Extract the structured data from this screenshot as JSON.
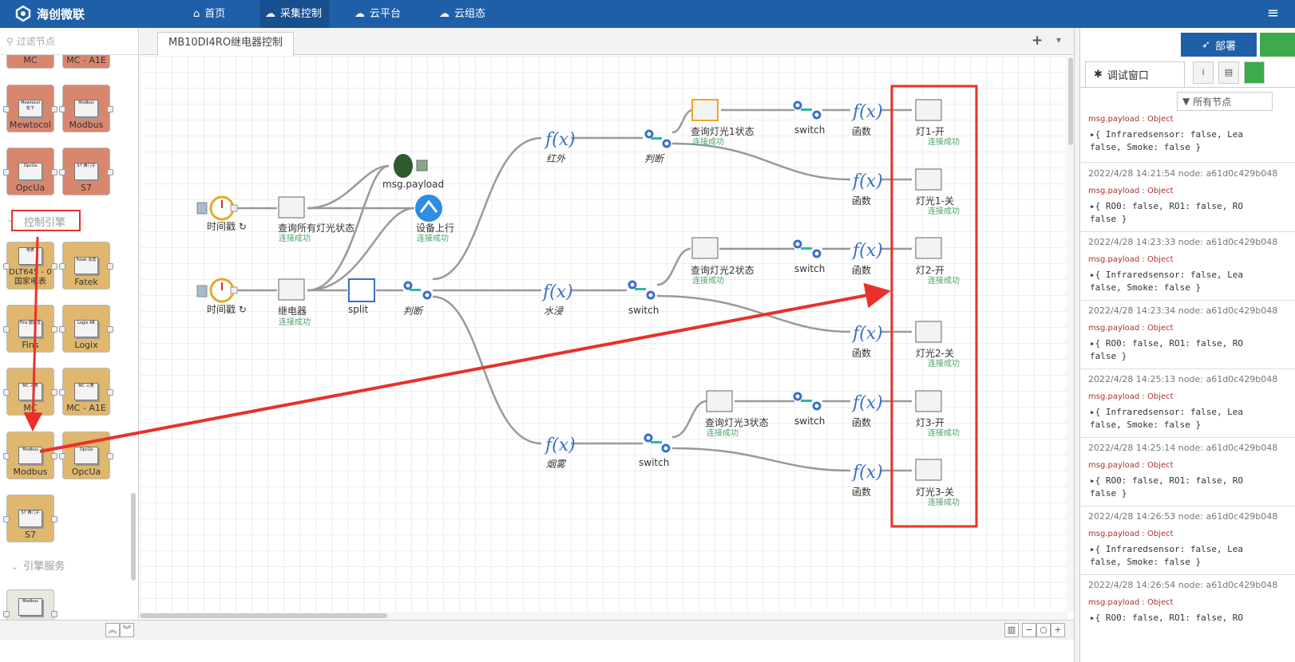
{
  "header": {
    "app_name": "海创微联",
    "nav": [
      {
        "label": "首页",
        "icon": "home-icon"
      },
      {
        "label": "采集控制",
        "icon": "cloud-gear-icon",
        "active": true
      },
      {
        "label": "云平台",
        "icon": "cloud-icon"
      },
      {
        "label": "云组态",
        "icon": "cloud-config-icon"
      }
    ]
  },
  "palette": {
    "filter_placeholder": "过滤节点",
    "top_partial": [
      "MC",
      "MC - A1E"
    ],
    "salmon_nodes": [
      {
        "label": "Mewtocol",
        "chip": "Mewtocol 松下"
      },
      {
        "label": "Modbus",
        "chip": "Modbus"
      },
      {
        "label": "OpcUa",
        "chip": "OpcUa"
      },
      {
        "label": "S7",
        "chip": "S7 西门子"
      }
    ],
    "category_control": "控制引擎",
    "tan_nodes": [
      {
        "label": "DLT645 - 0 国家电表",
        "chip": "电表"
      },
      {
        "label": "Fatek",
        "chip": "Fatek 永宏"
      },
      {
        "label": "Fins",
        "chip": "Fins 欧姆龙"
      },
      {
        "label": "Logix",
        "chip": "Logix AB"
      },
      {
        "label": "MC",
        "chip": "MC 三菱"
      },
      {
        "label": "MC - A1E",
        "chip": "MC 三菱"
      },
      {
        "label": "Modbus",
        "chip": "Modbus"
      },
      {
        "label": "OpcUa",
        "chip": "OpcUa"
      },
      {
        "label": "S7",
        "chip": "S7 西门子"
      }
    ],
    "category_service": "引擎服务",
    "service_chip": "Modbus"
  },
  "workspace": {
    "tab_title": "MB10DI4RO继电器控制",
    "add_label": "+",
    "menu_label": "▾"
  },
  "flow": {
    "status": "连接成功",
    "inject1": "时间戳 ↻",
    "inject2": "时间戳 ↻",
    "query_all": "查询所有灯光状态",
    "relay": "继电器",
    "split": "split",
    "debug": "msg.payload",
    "device_up": "设备上行",
    "judge1": "判断",
    "judge2": "判断",
    "fn_red": "红外",
    "fn_water": "水浸",
    "fn_smoke": "烟雾",
    "switch2": "switch",
    "switch3": "switch",
    "q1": "查询灯光1状态",
    "q2": "查询灯光2状态",
    "q3": "查询灯光3状态",
    "sw_a": "switch",
    "sw_b": "switch",
    "sw_c": "switch",
    "fn_label": "函数",
    "out1": "灯1-开",
    "out2": "灯光1-关",
    "out3": "灯2-开",
    "out4": "灯光2-关",
    "out5": "灯3-开",
    "out6": "灯光3-关"
  },
  "right": {
    "deploy": "部署",
    "debug_tab": "调试窗口",
    "filter": "所有节点",
    "messages": [
      {
        "meta": "",
        "topic": "msg.payload : Object",
        "body": "▸{ Infraredsensor: false, Lea\nfalse, Smoke: false }"
      },
      {
        "meta": "2022/4/28 14:21:54  node: a61d0c429b048",
        "topic": "msg.payload : Object",
        "body": "▸{ RO0: false, RO1: false, RO\nfalse }"
      },
      {
        "meta": "2022/4/28 14:23:33  node: a61d0c429b048",
        "topic": "msg.payload : Object",
        "body": "▸{ Infraredsensor: false, Lea\nfalse, Smoke: false }"
      },
      {
        "meta": "2022/4/28 14:23:34  node: a61d0c429b048",
        "topic": "msg.payload : Object",
        "body": "▸{ RO0: false, RO1: false, RO\nfalse }"
      },
      {
        "meta": "2022/4/28 14:25:13  node: a61d0c429b048",
        "topic": "msg.payload : Object",
        "body": "▸{ Infraredsensor: false, Lea\nfalse, Smoke: false }"
      },
      {
        "meta": "2022/4/28 14:25:14  node: a61d0c429b048",
        "topic": "msg.payload : Object",
        "body": "▸{ RO0: false, RO1: false, RO\nfalse }"
      },
      {
        "meta": "2022/4/28 14:26:53  node: a61d0c429b048",
        "topic": "msg.payload : Object",
        "body": "▸{ Infraredsensor: false, Lea\nfalse, Smoke: false }"
      },
      {
        "meta": "2022/4/28 14:26:54  node: a61d0c429b048",
        "topic": "msg.payload : Object",
        "body": "▸{ RO0: false, RO1: false, RO"
      }
    ]
  },
  "colors": {
    "header": "#1e5fa8",
    "annotation": "#e8312a",
    "salmon": "#d9866f",
    "tan": "#dfb76e",
    "status": "#4aa36b"
  }
}
